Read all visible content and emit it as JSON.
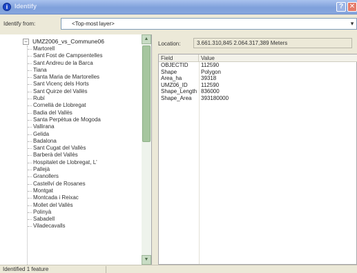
{
  "window": {
    "title": "Identify",
    "title_icon": "info-icon",
    "help_glyph": "?",
    "close_glyph": "✕"
  },
  "identify_from": {
    "label": "Identify from:",
    "value": "<Top-most layer>",
    "arrow": "▾"
  },
  "tree": {
    "expander_glyph": "−",
    "root_label": "UMZ2006_vs_Commune06",
    "items": [
      "Martorell",
      "Sant Fost de Campsentelles",
      "Sant Andreu de la Barca",
      "Tiana",
      "Santa Maria de Martorelles",
      "Sant Vicenç dels Horts",
      "Sant Quirze del Vallès",
      "Rubí",
      "Cornellà de Llobregat",
      "Badia del Vallès",
      "Santa Perpètua de Mogoda",
      "Vallirana",
      "Gelida",
      "Badalona",
      "Sant Cugat del Vallès",
      "Barberà del Vallès",
      "Hospitalet de Llobregat, L'",
      "Pallejà",
      "Granollers",
      "Castellví de Rosanes",
      "Montgat",
      "Montcada i Reixac",
      "Mollet del Vallès",
      "Polinyà",
      "Sabadell",
      "Viladecavalls"
    ],
    "scroll_up": "▲",
    "scroll_down": "▼"
  },
  "location": {
    "label": "Location:",
    "value": "3.661.310,845  2.064.317,389 Meters"
  },
  "attributes": {
    "columns": [
      "Field",
      "Value"
    ],
    "rows": [
      {
        "field": "OBJECTID",
        "value": "112590"
      },
      {
        "field": "Shape",
        "value": "Polygon"
      },
      {
        "field": "Area_ha",
        "value": "39318"
      },
      {
        "field": "UMZ06_ID",
        "value": "112590"
      },
      {
        "field": "Shape_Length",
        "value": "836000"
      },
      {
        "field": "Shape_Area",
        "value": "393180000"
      }
    ]
  },
  "status": {
    "text": "Identified 1 feature"
  }
}
